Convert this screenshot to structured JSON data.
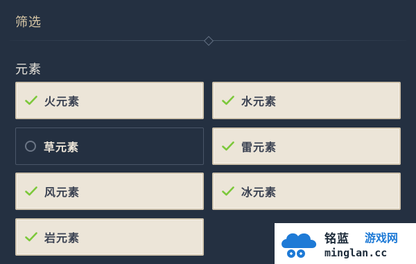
{
  "panel": {
    "title": "筛选",
    "section_label": "元素"
  },
  "options": [
    {
      "label": "火元素",
      "selected": true
    },
    {
      "label": "水元素",
      "selected": true
    },
    {
      "label": "草元素",
      "selected": false
    },
    {
      "label": "雷元素",
      "selected": true
    },
    {
      "label": "风元素",
      "selected": true
    },
    {
      "label": "冰元素",
      "selected": true
    },
    {
      "label": "岩元素",
      "selected": true
    }
  ],
  "watermark": {
    "brand_cn_1": "铭蓝",
    "brand_cn_2": "游戏网",
    "url": "minglan.cc"
  },
  "colors": {
    "background": "#243041",
    "selected_bg": "#ece5d8",
    "check_green": "#7cc83a",
    "title_gold": "#d9c8a6"
  },
  "icons": {
    "check": "check-icon",
    "radio": "radio-empty-icon"
  }
}
